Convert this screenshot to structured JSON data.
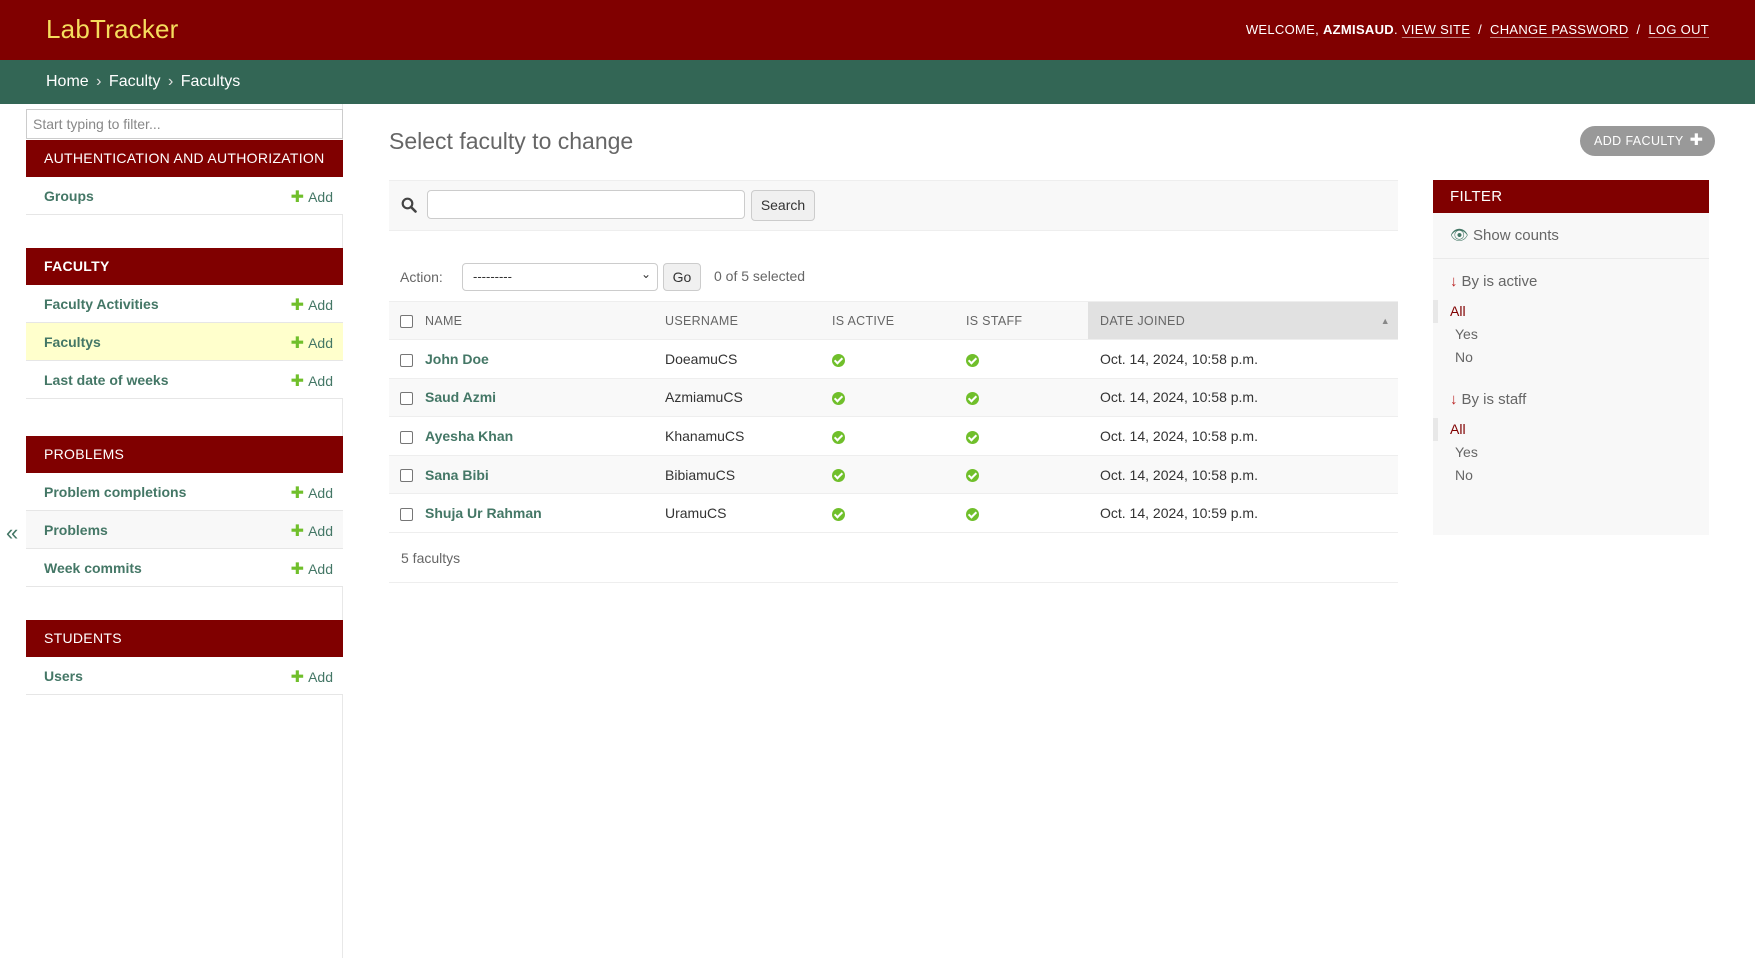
{
  "header": {
    "site_name": "LabTracker",
    "welcome": "WELCOME,",
    "username": "AZMISAUD",
    "view_site": "VIEW SITE",
    "change_password": "CHANGE PASSWORD",
    "log_out": "LOG OUT",
    "separator": "/"
  },
  "breadcrumbs": [
    "Home",
    "Faculty",
    "Facultys"
  ],
  "breadcrumb_sep": "›",
  "sidebar": {
    "filter_placeholder": "Start typing to filter...",
    "add_label": "Add",
    "modules": [
      {
        "caption": "Authentication and Authorization",
        "items": [
          "Groups"
        ]
      },
      {
        "caption": "Faculty",
        "items": [
          "Faculty Activities",
          "Facultys",
          "Last date of weeks"
        ]
      },
      {
        "caption": "Problems",
        "items": [
          "Problem completions",
          "Problems",
          "Week commits"
        ]
      },
      {
        "caption": "Students",
        "items": [
          "Users"
        ]
      }
    ],
    "collapse_icon": "«"
  },
  "main": {
    "title": "Select faculty to change",
    "add_button": "ADD FACULTY",
    "search_button": "Search",
    "action_label": "Action:",
    "action_selected": "---------",
    "go_button": "Go",
    "counter": "0 of 5 selected",
    "columns": [
      "Name",
      "Username",
      "Is active",
      "Is staff",
      "Date joined"
    ],
    "rows": [
      {
        "name": "John Doe",
        "username": "DoeamuCS",
        "is_active": true,
        "is_staff": true,
        "date_joined": "Oct. 14, 2024, 10:58 p.m."
      },
      {
        "name": "Saud Azmi",
        "username": "AzmiamuCS",
        "is_active": true,
        "is_staff": true,
        "date_joined": "Oct. 14, 2024, 10:58 p.m."
      },
      {
        "name": "Ayesha Khan",
        "username": "KhanamuCS",
        "is_active": true,
        "is_staff": true,
        "date_joined": "Oct. 14, 2024, 10:58 p.m."
      },
      {
        "name": "Sana Bibi",
        "username": "BibiamuCS",
        "is_active": true,
        "is_staff": true,
        "date_joined": "Oct. 14, 2024, 10:58 p.m."
      },
      {
        "name": "Shuja Ur Rahman",
        "username": "UramuCS",
        "is_active": true,
        "is_staff": true,
        "date_joined": "Oct. 14, 2024, 10:59 p.m."
      }
    ],
    "paginator": "5 facultys"
  },
  "filter": {
    "title": "FILTER",
    "show_counts": "Show counts",
    "groups": [
      {
        "title": "By is active",
        "options": [
          "All",
          "Yes",
          "No"
        ],
        "selected": "All"
      },
      {
        "title": "By is staff",
        "options": [
          "All",
          "Yes",
          "No"
        ],
        "selected": "All"
      }
    ]
  },
  "colors": {
    "header_bg": "#800000",
    "site_name": "#f5dd5d",
    "breadcrumb_bg": "#336655",
    "link": "#447766",
    "yes_icon": "#70bf2b"
  }
}
